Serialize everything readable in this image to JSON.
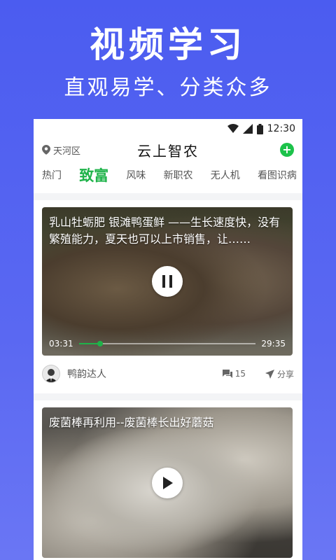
{
  "promo": {
    "title": "视频学习",
    "subtitle": "直观易学、分类众多"
  },
  "status_bar": {
    "time": "12:30",
    "icons": [
      "wifi-icon",
      "signal-icon",
      "battery-icon"
    ]
  },
  "header": {
    "location": "天河区",
    "app_title": "云上智农",
    "add_icon": "plus-icon"
  },
  "tabs": [
    {
      "label": "热门",
      "active": false
    },
    {
      "label": "致富",
      "active": true
    },
    {
      "label": "风味",
      "active": false
    },
    {
      "label": "新职农",
      "active": false
    },
    {
      "label": "无人机",
      "active": false
    },
    {
      "label": "看图识病",
      "active": false
    }
  ],
  "videos": [
    {
      "title": "乳山牡蛎肥 银滩鸭蛋鲜 ——生长速度快，没有繁殖能力，夏天也可以上市销售，让……",
      "state": "playing",
      "current_time": "03:31",
      "duration": "29:35",
      "progress": 0.12,
      "author": "鸭韵达人",
      "comments": "15",
      "share_label": "分享"
    },
    {
      "title": "废菌棒再利用--废菌棒长出好蘑菇",
      "state": "paused"
    }
  ],
  "colors": {
    "background": "#4b5cf0",
    "accent_green": "#1fb34a"
  }
}
